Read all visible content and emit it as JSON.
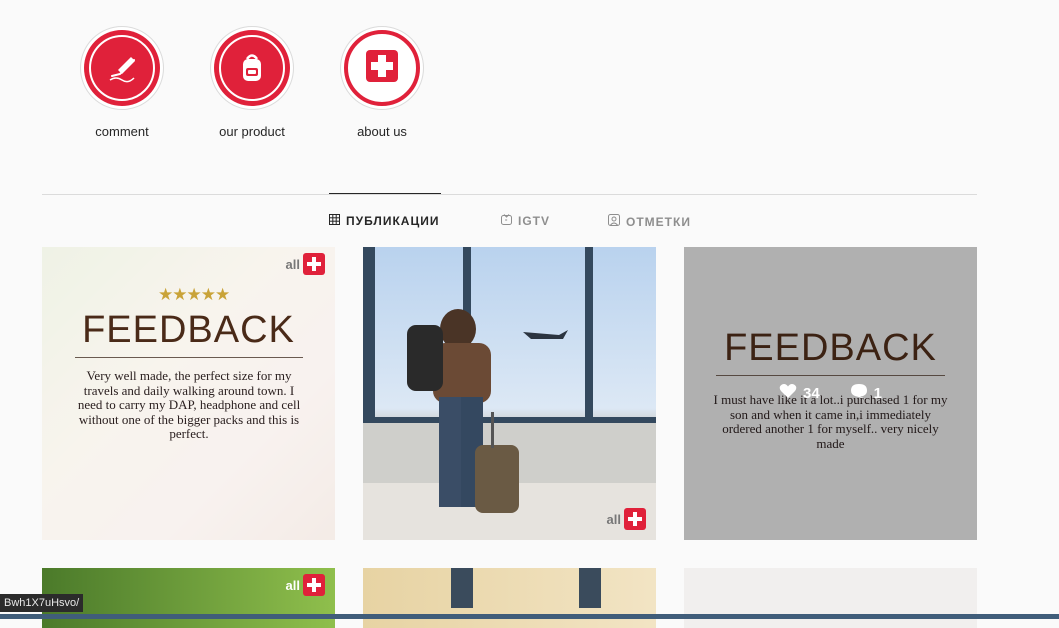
{
  "highlights": [
    {
      "label": "comment",
      "icon": "pen-signature-icon"
    },
    {
      "label": "our product",
      "icon": "backpack-icon"
    },
    {
      "label": "about us",
      "icon": "swiss-cross-icon"
    }
  ],
  "tabs": [
    {
      "label": "ПУБЛИКАЦИИ",
      "icon": "grid-icon",
      "active": true
    },
    {
      "label": "IGTV",
      "icon": "igtv-icon",
      "active": false
    },
    {
      "label": "ОТМЕТКИ",
      "icon": "tagged-icon",
      "active": false
    }
  ],
  "posts": [
    {
      "title": "FEEDBACK",
      "text": "Very well made, the perfect size for my travels and daily walking around town. I need to carry my DAP, headphone and cell without one of the bigger packs and this is perfect.",
      "logo": "all"
    },
    {
      "logo": "all"
    },
    {
      "title": "FEEDBACK",
      "text": "I must have like it a lot..i purchased 1 for my son and when it came in,i immediately ordered another 1 for myself.. very nicely made",
      "likes": "34",
      "comments": "1"
    }
  ],
  "row2": [
    {
      "logo": "all"
    }
  ],
  "status_url": "Bwh1X7uHsvo/",
  "colors": {
    "brand": "#e0213a",
    "background": "#fafafa"
  }
}
